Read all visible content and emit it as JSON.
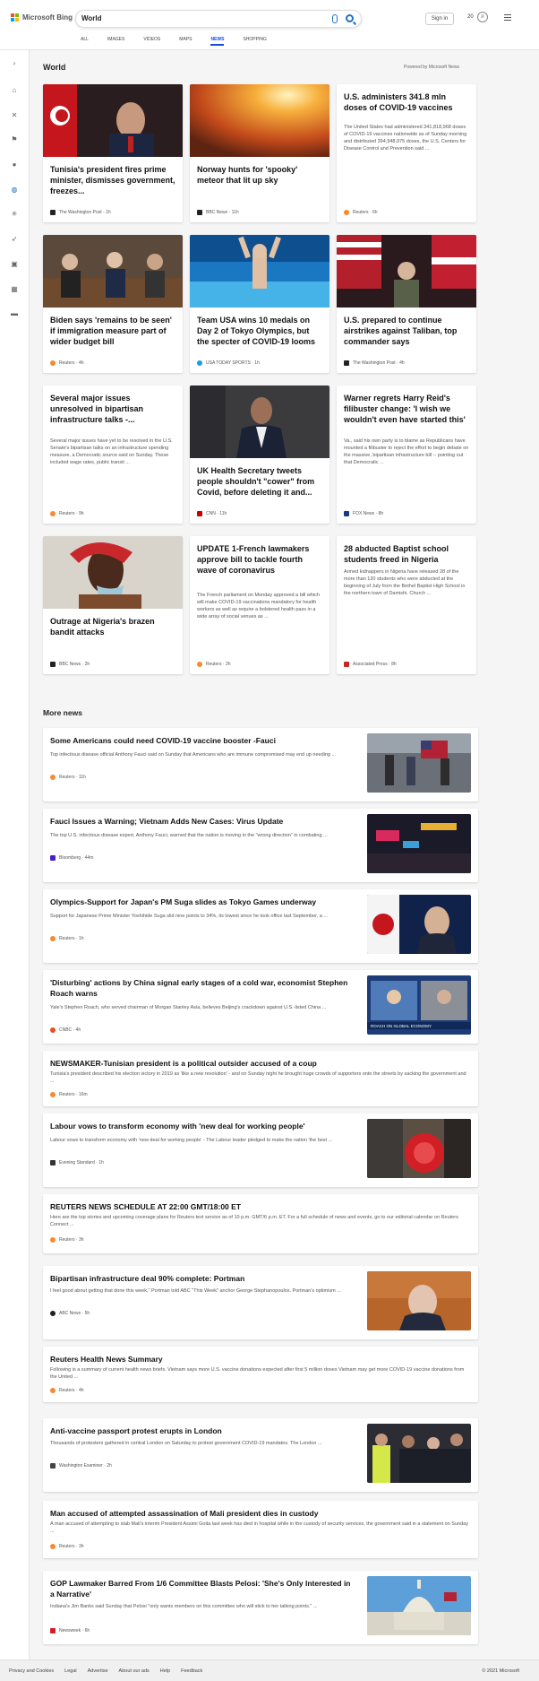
{
  "header": {
    "brand": "Microsoft Bing",
    "search_value": "World",
    "signin_label": "Sign in",
    "rewards_count": "20",
    "tabs": [
      "ALL",
      "IMAGES",
      "VIDEOS",
      "MAPS",
      "NEWS",
      "SHOPPING"
    ],
    "active_tab": "NEWS"
  },
  "section": {
    "title": "World",
    "powered": "Powered by Microsoft News"
  },
  "cards": [
    {
      "title": "Tunisia's president fires prime minister, dismisses government, freezes...",
      "source": "The Washington Post",
      "time": "1h"
    },
    {
      "title": "Norway hunts for 'spooky' meteor that lit up sky",
      "source": "BBC News",
      "time": "11h"
    },
    {
      "title": "U.S. administers 341.8 mln doses of COVID-19 vaccines",
      "snippet": "The United States had administered 341,818,968 doses of COVID-19 vaccines nationwide as of Sunday morning and distributed 394,948,975 doses, the U.S. Centers for Disease Control and Prevention said ...",
      "source": "Reuters",
      "time": "6h"
    },
    {
      "title": "Biden says 'remains to be seen' if immigration measure part of wider budget bill",
      "source": "Reuters",
      "time": "4h"
    },
    {
      "title": "Team USA wins 10 medals on Day 2 of Tokyo Olympics, but the specter of COVID-19 looms",
      "source": "USA TODAY SPORTS",
      "time": "1h"
    },
    {
      "title": "U.S. prepared to continue airstrikes against Taliban, top commander says",
      "source": "The Washington Post",
      "time": "4h"
    },
    {
      "title": "Several major issues unresolved in bipartisan infrastructure talks -...",
      "snippet": "Several major issues have yet to be resolved in the U.S. Senate's bipartisan talks on an infrastructure spending measure, a Democratic source said on Sunday. These included wage rates, public transit ...",
      "source": "Reuters",
      "time": "9h"
    },
    {
      "title": "UK Health Secretary tweets people shouldn't \"cower\" from Covid, before deleting it and...",
      "source": "CNN",
      "time": "11h"
    },
    {
      "title": "Warner regrets Harry Reid's filibuster change: 'I wish we wouldn't even have started this'",
      "snippet": "Va., said his own party is to blame as Republicans have mounted a filibuster to reject the effort to begin debate on the massive, bipartisan infrastructure bill -- pointing out that Democratic ...",
      "source": "FOX News",
      "time": "8h"
    },
    {
      "title": "Outrage at Nigeria's brazen bandit attacks",
      "source": "BBC News",
      "time": "2h"
    },
    {
      "title": "UPDATE 1-French lawmakers approve bill to tackle fourth wave of coronavirus",
      "snippet": "The French parliament on Monday approved a bill which will make COVID-19 vaccinations mandatory for health workers as well as require a bolstered health pass in a wide array of social venues as ...",
      "source": "Reuters",
      "time": "2h"
    },
    {
      "title": "28 abducted Baptist school students freed in Nigeria",
      "snippet": "Armed kidnappers in Nigeria have released 28 of the more than 120 students who were abducted at the beginning of July from the Bethel Baptist High School in the northern town of Damishi. Church ...",
      "source": "Associated Press",
      "time": "8h"
    }
  ],
  "more_news_title": "More news",
  "more_news": [
    {
      "title": "Some Americans could need COVID-19 vaccine booster -Fauci",
      "snippet": "Top infectious disease official Anthony Fauci said on Sunday that Americans who are immune compromised may end up needing ...",
      "source": "Reuters",
      "time": "11h"
    },
    {
      "title": "Fauci Issues a Warning; Vietnam Adds New Cases: Virus Update",
      "snippet": "The top U.S. infectious disease expert, Anthony Fauci, warned that the nation is moving in the \"wrong direction\" in combating ...",
      "source": "Bloomberg",
      "time": "44m"
    },
    {
      "title": "Olympics-Support for Japan's PM Suga slides as Tokyo Games underway",
      "snippet": "Support for Japanese Prime Minister Yoshihide Suga slid nine points to 34%, its lowest since he took office last September, a ...",
      "source": "Reuters",
      "time": "1h"
    },
    {
      "title": "'Disturbing' actions by China signal early stages of a cold war, economist Stephen Roach warns",
      "snippet": "Yale's Stephen Roach, who served chairman of Morgan Stanley Asia, believes Beijing's crackdown against U.S.-listed China ...",
      "source": "CNBC",
      "time": "4h",
      "thumb_caption": "ROACH ON GLOBAL ECONOMY"
    },
    {
      "title": "NEWSMAKER-Tunisian president is a political outsider accused of a coup",
      "snippet": "Tunisia's president described his election victory in 2019 as 'like a new revolution' - and on Sunday night he brought huge crowds of supporters onto the streets by sacking the government and ...",
      "source": "Reuters",
      "time": "16m"
    },
    {
      "title": "Labour vows to transform economy with 'new deal for working people'",
      "snippet": "Labour vows to transform economy with 'new deal for working people' - The Labour leader pledged to make the nation 'the best ...",
      "source": "Evening Standard",
      "time": "1h"
    },
    {
      "title": "REUTERS NEWS SCHEDULE AT 22:00 GMT/18:00 ET",
      "snippet": "Here are the top stories and upcoming coverage plans for Reuters text service as of 10 p.m. GMT/6 p.m. ET. For a full schedule of news and events, go to our editorial calendar on Reuters Connect ...",
      "source": "Reuters",
      "time": "3h"
    },
    {
      "title": "Bipartisan infrastructure deal 90% complete: Portman",
      "snippet": "I feel good about getting that done this week,\" Portman told ABC \"This Week\" anchor George Stephanopoulos. Portman's optimism ...",
      "source": "ABC News",
      "time": "5h"
    },
    {
      "title": "Reuters Health News Summary",
      "snippet": "Following is a summary of current health news briefs. Vietnam says more U.S. vaccine donations expected after first 5 million doses Vietnam may get more COVID-19 vaccine donations from the United ...",
      "source": "Reuters",
      "time": "4h"
    },
    {
      "title": "Anti-vaccine passport protest erupts in London",
      "snippet": "Thousands of protesters gathered in central London on Saturday to protest government COVID-19 mandates. The London ...",
      "source": "Washington Examiner",
      "time": "2h"
    },
    {
      "title": "Man accused of attempted assassination of Mali president dies in custody",
      "snippet": "A man accused of attempting to stab Mali's interim President Assimi Goita last week has died in hospital while in the custody of security services, the government said in a statement on Sunday ...",
      "source": "Reuters",
      "time": "3h"
    },
    {
      "title": "GOP Lawmaker Barred From 1/6 Committee Blasts Pelosi: 'She's Only Interested in a Narrative'",
      "snippet": "Indiana's Jim Banks said Sunday that Pelosi \"only wants members on this committee who will stick to her talking points.\" ...",
      "source": "Newsweek",
      "time": "6h"
    }
  ],
  "footer": {
    "links": [
      "Privacy and Cookies",
      "Legal",
      "Advertise",
      "About our ads",
      "Help",
      "Feedback"
    ],
    "copyright": "© 2021 Microsoft"
  },
  "colors": {
    "accent": "#174ae4",
    "search_icon": "#1a73c4",
    "reuters": "#f58a33"
  },
  "icons": [
    "search-icon",
    "mic-icon",
    "trophy-icon",
    "menu-icon",
    "chevron-right-icon",
    "home-icon",
    "sports-icon",
    "flag-icon",
    "pin-icon",
    "globe-icon",
    "rocket-icon",
    "film-icon",
    "building-icon",
    "money-icon"
  ]
}
